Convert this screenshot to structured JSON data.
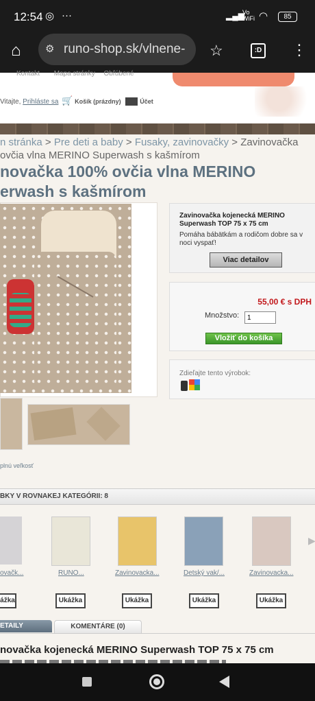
{
  "status": {
    "time": "12:54",
    "battery": "85",
    "network": "Vo WiFi"
  },
  "browser": {
    "url": "runo-shop.sk/vlnene-",
    "tab_label": ":D"
  },
  "header": {
    "top_links": [
      "Kontakt",
      "Mapa stránky",
      "Obľúbené"
    ],
    "welcome": "Vitajte,",
    "login": "Prihláste sa",
    "cart": "Košík (prázdny)",
    "account": "Účet"
  },
  "breadcrumb": {
    "items": [
      "n stránka",
      "Pre deti a baby",
      "Fusaky, zavinovačky",
      "Zavinovačka"
    ],
    "line2": "ovčia vlna MERINO Superwash s kašmírom"
  },
  "product": {
    "title_line1": "novačka 100% ovčia vlna MERINO",
    "title_line2": "erwash s kašmírom",
    "full_size": "plnú veľkosť",
    "info_title": "Zavinovačka kojenecká MERINO Superwash TOP 75 x 75 cm",
    "info_desc": "Pomáha bábätkám a rodičom dobre sa v noci vyspať!",
    "details_button": "Viac detailov",
    "price": "55,00 € s DPH",
    "qty_label": "Množstvo:",
    "qty_value": "1",
    "add_to_cart": "Vložiť do košíka",
    "share_label": "Zdieľajte tento výrobok:"
  },
  "related": {
    "header": "BKY V ROVNAKEJ KATEGÓRII: 8",
    "items": [
      {
        "label": "ovačk...",
        "button": "ážka"
      },
      {
        "label": "RUNO...",
        "button": "Ukážka"
      },
      {
        "label": "Zavinovacka...",
        "button": "Ukážka"
      },
      {
        "label": "Detský vak/...",
        "button": "Ukážka"
      },
      {
        "label": "Zavinovacka...",
        "button": "Ukážka"
      }
    ]
  },
  "tabs": {
    "details": "ETAILY",
    "comments": "KOMENTÁRE (0)"
  },
  "bottom": {
    "heading": "novačka kojenecká MERINO Superwash TOP 75 x 75 cm"
  },
  "colors": {
    "title": "#5d7180",
    "price": "#c2181b",
    "link": "#7d95a6",
    "green_button": "#4aa62f"
  }
}
